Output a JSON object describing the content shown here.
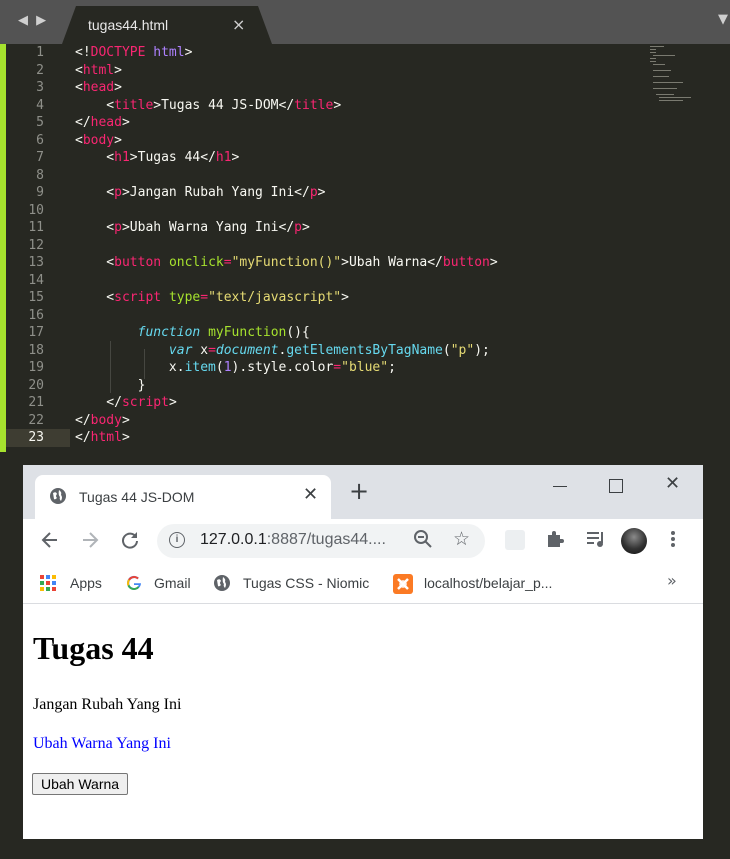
{
  "editor": {
    "tab_title": "tugas44.html",
    "tab_close": "×",
    "nav_arrows": "◀ ▶",
    "dropdown": "▼",
    "current_line": 23,
    "lines": [
      {
        "n": "1",
        "tokens": [
          [
            "plain",
            "<!"
          ],
          [
            "tag",
            "DOCTYPE"
          ],
          [
            "plain",
            " "
          ],
          [
            "doctype",
            "html"
          ],
          [
            "plain",
            ">"
          ]
        ]
      },
      {
        "n": "2",
        "tokens": [
          [
            "plain",
            "<"
          ],
          [
            "tag",
            "html"
          ],
          [
            "plain",
            ">"
          ]
        ]
      },
      {
        "n": "3",
        "tokens": [
          [
            "plain",
            "<"
          ],
          [
            "tag",
            "head"
          ],
          [
            "plain",
            ">"
          ]
        ]
      },
      {
        "n": "4",
        "tokens": [
          [
            "plain",
            "    <"
          ],
          [
            "tag",
            "title"
          ],
          [
            "plain",
            ">Tugas 44 JS-DOM</"
          ],
          [
            "tag",
            "title"
          ],
          [
            "plain",
            ">"
          ]
        ]
      },
      {
        "n": "5",
        "tokens": [
          [
            "plain",
            "</"
          ],
          [
            "tag",
            "head"
          ],
          [
            "plain",
            ">"
          ]
        ]
      },
      {
        "n": "6",
        "tokens": [
          [
            "plain",
            "<"
          ],
          [
            "tag",
            "body"
          ],
          [
            "plain",
            ">"
          ]
        ]
      },
      {
        "n": "7",
        "tokens": [
          [
            "plain",
            "    <"
          ],
          [
            "tag",
            "h1"
          ],
          [
            "plain",
            ">Tugas 44</"
          ],
          [
            "tag",
            "h1"
          ],
          [
            "plain",
            ">"
          ]
        ]
      },
      {
        "n": "8",
        "tokens": []
      },
      {
        "n": "9",
        "tokens": [
          [
            "plain",
            "    <"
          ],
          [
            "tag",
            "p"
          ],
          [
            "plain",
            ">Jangan Rubah Yang Ini</"
          ],
          [
            "tag",
            "p"
          ],
          [
            "plain",
            ">"
          ]
        ]
      },
      {
        "n": "10",
        "tokens": []
      },
      {
        "n": "11",
        "tokens": [
          [
            "plain",
            "    <"
          ],
          [
            "tag",
            "p"
          ],
          [
            "plain",
            ">Ubah Warna Yang Ini</"
          ],
          [
            "tag",
            "p"
          ],
          [
            "plain",
            ">"
          ]
        ]
      },
      {
        "n": "12",
        "tokens": []
      },
      {
        "n": "13",
        "tokens": [
          [
            "plain",
            "    <"
          ],
          [
            "tag",
            "button"
          ],
          [
            "plain",
            " "
          ],
          [
            "attr",
            "onclick"
          ],
          [
            "op",
            "="
          ],
          [
            "str",
            "\"myFunction()\""
          ],
          [
            "plain",
            ">Ubah Warna</"
          ],
          [
            "tag",
            "button"
          ],
          [
            "plain",
            ">"
          ]
        ]
      },
      {
        "n": "14",
        "tokens": []
      },
      {
        "n": "15",
        "tokens": [
          [
            "plain",
            "    <"
          ],
          [
            "tag",
            "script"
          ],
          [
            "plain",
            " "
          ],
          [
            "attr",
            "type"
          ],
          [
            "op",
            "="
          ],
          [
            "str",
            "\"text/javascript\""
          ],
          [
            "plain",
            ">"
          ]
        ]
      },
      {
        "n": "16",
        "tokens": []
      },
      {
        "n": "17",
        "tokens": [
          [
            "plain",
            "        "
          ],
          [
            "kw",
            "function"
          ],
          [
            "plain",
            " "
          ],
          [
            "fn",
            "myFunction"
          ],
          [
            "plain",
            "(){"
          ]
        ]
      },
      {
        "n": "18",
        "tokens": [
          [
            "plain",
            "            "
          ],
          [
            "kw",
            "var"
          ],
          [
            "plain",
            " x"
          ],
          [
            "op",
            "="
          ],
          [
            "kw",
            "document"
          ],
          [
            "plain",
            "."
          ],
          [
            "prop",
            "getElementsByTagName"
          ],
          [
            "plain",
            "("
          ],
          [
            "str",
            "\"p\""
          ],
          [
            "plain",
            ");"
          ]
        ]
      },
      {
        "n": "19",
        "tokens": [
          [
            "plain",
            "            x."
          ],
          [
            "prop",
            "item"
          ],
          [
            "plain",
            "("
          ],
          [
            "num",
            "1"
          ],
          [
            "plain",
            ").style.color"
          ],
          [
            "op",
            "="
          ],
          [
            "str",
            "\"blue\""
          ],
          [
            "plain",
            ";"
          ]
        ]
      },
      {
        "n": "20",
        "tokens": [
          [
            "plain",
            "        }"
          ]
        ]
      },
      {
        "n": "21",
        "tokens": [
          [
            "plain",
            "    </"
          ],
          [
            "tag",
            "script"
          ],
          [
            "plain",
            ">"
          ]
        ]
      },
      {
        "n": "22",
        "tokens": [
          [
            "plain",
            "</"
          ],
          [
            "tag",
            "body"
          ],
          [
            "plain",
            ">"
          ]
        ]
      },
      {
        "n": "23",
        "tokens": [
          [
            "plain",
            "</"
          ],
          [
            "tag",
            "html"
          ],
          [
            "plain",
            ">"
          ]
        ]
      }
    ]
  },
  "browser": {
    "tab_title": "Tugas 44 JS-DOM",
    "tab_close": "✕",
    "new_tab": "+",
    "window_close": "✕",
    "url_host": "127.0.0.1",
    "url_rest": ":8887/tugas44....",
    "bookmarks": [
      {
        "label": "Apps",
        "icon": "apps-grid-icon"
      },
      {
        "label": "Gmail",
        "icon": "google-g-icon"
      },
      {
        "label": "Tugas CSS - Niomic",
        "icon": "globe-icon"
      },
      {
        "label": "localhost/belajar_p...",
        "icon": "xampp-icon"
      }
    ],
    "bookmarks_more": "»",
    "colors": {
      "paragraph_changed": "#0000ff",
      "titlebar": "#dee1e6"
    }
  },
  "page": {
    "heading": "Tugas 44",
    "paragraph_1": "Jangan Rubah Yang Ini",
    "paragraph_2": "Ubah Warna Yang Ini",
    "button_label": "Ubah Warna"
  }
}
